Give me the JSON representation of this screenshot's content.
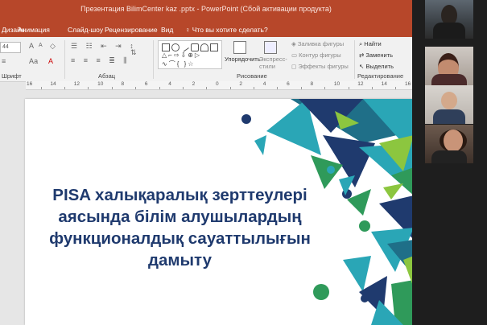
{
  "window": {
    "title": "Презентация BilimCenter kaz .pptx  -  PowerPoint (Сбой активации продукта)",
    "controls": "—  ❐  ✕"
  },
  "tabs": [
    "Дизайн",
    "Анимация",
    "Слайд-шоу",
    "Рецензирование",
    "Вид"
  ],
  "tell_me": "Что вы хотите сделать?",
  "ribbon": {
    "font_size": "44",
    "groups": {
      "font": "Шрифт",
      "paragraph": "Абзац",
      "drawing": "Рисование",
      "editing": "Редактирование"
    },
    "arrange": "Упорядочить",
    "quick_styles": "Экспресс-стили",
    "shape_fill": "Заливка фигуры",
    "shape_outline": "Контур фигуры",
    "shape_effects": "Эффекты фигуры",
    "find": "Найти",
    "replace": "Заменить",
    "select": "Выделить"
  },
  "ruler_labels": [
    "16",
    "14",
    "12",
    "10",
    "8",
    "6",
    "4",
    "2",
    "0",
    "2",
    "4",
    "6",
    "8",
    "10",
    "12",
    "14",
    "16"
  ],
  "slide": {
    "title_lines": [
      "PISA  халықаралық зерттеулері",
      "аясында білім алушылардың",
      "функционалдық сауаттылығын",
      "дамыту"
    ],
    "colors": {
      "title": "#1f3a6e",
      "navy": "#1f3a6e",
      "teal": "#2aa6b6",
      "green": "#2f9a5a",
      "light_green": "#8cc63f"
    }
  },
  "colors": {
    "accent": "#b7472a",
    "ribbon": "#f1f1f1"
  }
}
